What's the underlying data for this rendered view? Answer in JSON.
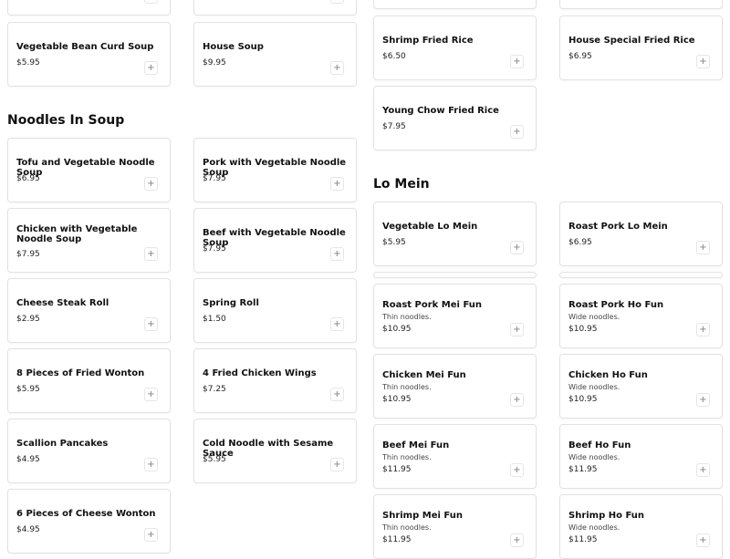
{
  "add_symbol": "+",
  "sections": {
    "noodles_in_soup": "Noodles In Soup",
    "lo_mein": "Lo Mein"
  },
  "left_col": {
    "vegetable_bean_curd_soup": {
      "name": "Vegetable Bean Curd Soup",
      "price": "$5.95"
    },
    "house_soup": {
      "name": "House Soup",
      "price": "$9.95"
    },
    "tofu_vegetable_noodle_soup": {
      "name": "Tofu and Vegetable Noodle Soup",
      "price": "$6.95"
    },
    "pork_vegetable_noodle_soup": {
      "name": "Pork with Vegetable Noodle Soup",
      "price": "$7.95"
    },
    "chicken_vegetable_noodle_soup": {
      "name": "Chicken with Vegetable Noodle Soup",
      "price": "$7.95"
    },
    "beef_vegetable_noodle_soup": {
      "name": "Beef with Vegetable Noodle Soup",
      "price": "$7.95"
    },
    "cheese_steak_roll": {
      "name": "Cheese Steak Roll",
      "price": "$2.95"
    },
    "spring_roll": {
      "name": "Spring Roll",
      "price": "$1.50"
    },
    "fried_wonton": {
      "name": "8 Pieces of Fried Wonton",
      "price": "$5.95"
    },
    "fried_chicken_wings": {
      "name": "4 Fried Chicken Wings",
      "price": "$7.25"
    },
    "scallion_pancakes": {
      "name": "Scallion Pancakes",
      "price": "$4.95"
    },
    "cold_noodle_sesame": {
      "name": "Cold Noodle with Sesame Sauce",
      "price": "$5.95"
    },
    "cheese_wonton": {
      "name": "6 Pieces of Cheese Wonton",
      "price": "$4.95"
    }
  },
  "right_col": {
    "shrimp_fried_rice": {
      "name": "Shrimp Fried Rice",
      "price": "$6.50"
    },
    "house_special_fried_rice": {
      "name": "House Special Fried Rice",
      "price": "$6.95"
    },
    "young_chow_fried_rice": {
      "name": "Young Chow Fried Rice",
      "price": "$7.95"
    },
    "vegetable_lo_mein": {
      "name": "Vegetable Lo Mein",
      "price": "$5.95"
    },
    "roast_pork_lo_mein": {
      "name": "Roast Pork Lo Mein",
      "price": "$6.95"
    },
    "roast_pork_mei_fun": {
      "name": "Roast Pork Mei Fun",
      "desc": "Thin noodles.",
      "price": "$10.95"
    },
    "roast_pork_ho_fun": {
      "name": "Roast Pork Ho Fun",
      "desc": "Wide noodles.",
      "price": "$10.95"
    },
    "chicken_mei_fun": {
      "name": "Chicken Mei Fun",
      "desc": "Thin noodles.",
      "price": "$10.95"
    },
    "chicken_ho_fun": {
      "name": "Chicken Ho Fun",
      "desc": "Wide noodles.",
      "price": "$10.95"
    },
    "beef_mei_fun": {
      "name": "Beef Mei Fun",
      "desc": "Thin noodles.",
      "price": "$11.95"
    },
    "beef_ho_fun": {
      "name": "Beef Ho Fun",
      "desc": "Wide noodles.",
      "price": "$11.95"
    },
    "shrimp_mei_fun": {
      "name": "Shrimp Mei Fun",
      "desc": "Thin noodles.",
      "price": "$11.95"
    },
    "shrimp_ho_fun": {
      "name": "Shrimp Ho Fun",
      "desc": "Wide noodles.",
      "price": "$11.95"
    }
  }
}
